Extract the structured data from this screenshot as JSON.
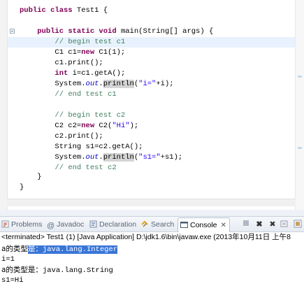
{
  "editor": {
    "lines": [
      {
        "parts": [
          {
            "t": "public class",
            "c": "kw"
          },
          {
            "t": " Test1 {",
            "c": ""
          }
        ]
      },
      {
        "parts": []
      },
      {
        "parts": [
          {
            "t": "    ",
            "c": ""
          },
          {
            "t": "public static void",
            "c": "kw"
          },
          {
            "t": " main(String[] args) {",
            "c": ""
          }
        ]
      },
      {
        "parts": [
          {
            "t": "        ",
            "c": ""
          },
          {
            "t": "// begin test c1",
            "c": "cm"
          }
        ]
      },
      {
        "parts": [
          {
            "t": "        C1 c1=",
            "c": ""
          },
          {
            "t": "new",
            "c": "kw"
          },
          {
            "t": " C1(1);",
            "c": ""
          }
        ]
      },
      {
        "parts": [
          {
            "t": "        c1.print();",
            "c": ""
          }
        ]
      },
      {
        "parts": [
          {
            "t": "        ",
            "c": ""
          },
          {
            "t": "int",
            "c": "kw"
          },
          {
            "t": " i=c1.getA();",
            "c": ""
          }
        ]
      },
      {
        "parts": [
          {
            "t": "        System.",
            "c": ""
          },
          {
            "t": "out",
            "c": "fld"
          },
          {
            "t": ".",
            "c": ""
          },
          {
            "t": "println",
            "c": "mhl"
          },
          {
            "t": "(",
            "c": ""
          },
          {
            "t": "\"i=\"",
            "c": "st"
          },
          {
            "t": "+i);",
            "c": ""
          }
        ]
      },
      {
        "parts": [
          {
            "t": "        ",
            "c": ""
          },
          {
            "t": "// end test c1",
            "c": "cm"
          }
        ]
      },
      {
        "parts": []
      },
      {
        "parts": [
          {
            "t": "        ",
            "c": ""
          },
          {
            "t": "// begin test c2",
            "c": "cm"
          }
        ]
      },
      {
        "parts": [
          {
            "t": "        C2 c2=",
            "c": ""
          },
          {
            "t": "new",
            "c": "kw"
          },
          {
            "t": " C2(",
            "c": ""
          },
          {
            "t": "\"Hi\"",
            "c": "st"
          },
          {
            "t": ");",
            "c": ""
          }
        ]
      },
      {
        "parts": [
          {
            "t": "        c2.print();",
            "c": ""
          }
        ]
      },
      {
        "parts": [
          {
            "t": "        String s1=c2.getA();",
            "c": ""
          }
        ]
      },
      {
        "parts": [
          {
            "t": "        System.",
            "c": ""
          },
          {
            "t": "out",
            "c": "fld"
          },
          {
            "t": ".",
            "c": ""
          },
          {
            "t": "println",
            "c": "mhl"
          },
          {
            "t": "(",
            "c": ""
          },
          {
            "t": "\"s1=\"",
            "c": "st"
          },
          {
            "t": "+s1);",
            "c": ""
          }
        ]
      },
      {
        "parts": [
          {
            "t": "        ",
            "c": ""
          },
          {
            "t": "// end test c2",
            "c": "cm"
          }
        ]
      },
      {
        "parts": [
          {
            "t": "    }",
            "c": ""
          }
        ]
      },
      {
        "parts": [
          {
            "t": "}",
            "c": ""
          }
        ]
      }
    ]
  },
  "tabs": [
    {
      "label": "Problems",
      "icon": "problems-icon"
    },
    {
      "label": "Javadoc",
      "icon": "at-icon"
    },
    {
      "label": "Declaration",
      "icon": "declaration-icon"
    },
    {
      "label": "Search",
      "icon": "search-icon"
    },
    {
      "label": "Console",
      "icon": "console-icon",
      "active": true
    }
  ],
  "console": {
    "status": "<terminated> Test1 (1) [Java Application] D:\\jdk1.6\\bin\\javaw.exe (2013年10月11日 上午8",
    "output": {
      "line1_prefix": "a的类型",
      "line1_selected": "是：java.lang.Integer",
      "line2": "i=1",
      "line3_prefix": "a的类型是：",
      "line3_rest": "java.lang.String",
      "line4": "s1=Hi"
    }
  },
  "colors": {
    "keyword": "#7f0055",
    "comment": "#3f7f5f",
    "string": "#2a00ff",
    "selection": "#3875d7"
  }
}
